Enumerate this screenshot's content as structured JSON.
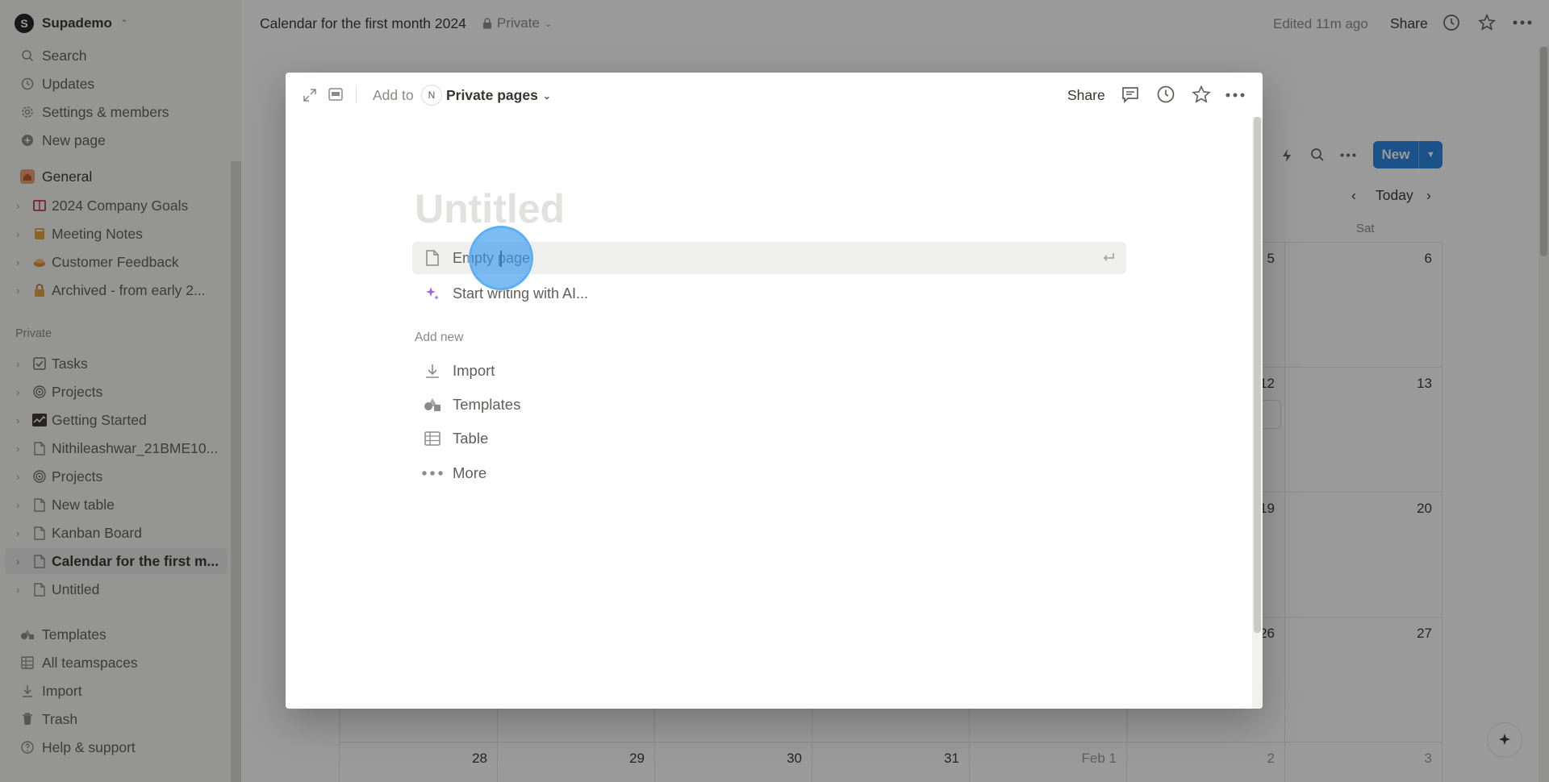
{
  "workspace": {
    "initial": "S",
    "name": "Supademo"
  },
  "sidebar": {
    "top_items": [
      {
        "label": "Search",
        "icon": "search-icon"
      },
      {
        "label": "Updates",
        "icon": "clock-icon"
      },
      {
        "label": "Settings & members",
        "icon": "gear-icon"
      },
      {
        "label": "New page",
        "icon": "plus-circle-icon"
      }
    ],
    "teamspace_items": [
      {
        "label": "General",
        "icon": "home-icon"
      },
      {
        "label": "2024 Company Goals",
        "icon": "book-icon"
      },
      {
        "label": "Meeting Notes",
        "icon": "notebook-icon"
      },
      {
        "label": "Customer Feedback",
        "icon": "food-icon"
      },
      {
        "label": "Archived - from early 2...",
        "icon": "lock-icon"
      }
    ],
    "private_label": "Private",
    "private_items": [
      {
        "label": "Tasks",
        "icon": "checkbox-icon"
      },
      {
        "label": "Projects",
        "icon": "target-icon"
      },
      {
        "label": "Getting Started",
        "icon": "chart-icon"
      },
      {
        "label": "Nithileashwar_21BME10...",
        "icon": "page-icon"
      },
      {
        "label": "Projects",
        "icon": "target-icon"
      },
      {
        "label": "New table",
        "icon": "page-icon"
      },
      {
        "label": "Kanban Board",
        "icon": "page-icon"
      },
      {
        "label": "Calendar for the first m...",
        "icon": "page-icon"
      },
      {
        "label": "Untitled",
        "icon": "page-icon"
      }
    ],
    "bottom_items": [
      {
        "label": "Templates",
        "icon": "templates-icon"
      },
      {
        "label": "All teamspaces",
        "icon": "grid-icon"
      },
      {
        "label": "Import",
        "icon": "download-icon"
      },
      {
        "label": "Trash",
        "icon": "trash-icon"
      },
      {
        "label": "Help & support",
        "icon": "help-icon"
      }
    ]
  },
  "topbar": {
    "title": "Calendar for the first month 2024",
    "privacy": "Private",
    "edited": "Edited 11m ago",
    "share": "Share"
  },
  "calendar": {
    "new_label": "New",
    "today_label": "Today",
    "day_header": "Sat",
    "dates": [
      "5",
      "6",
      "12",
      "13",
      "19",
      "20",
      "26",
      "27",
      "28",
      "29",
      "30",
      "31",
      "Feb 1",
      "2",
      "3"
    ]
  },
  "modal": {
    "add_to": "Add to",
    "location_initial": "N",
    "location": "Private pages",
    "share": "Share",
    "title_placeholder": "Untitled",
    "options": [
      {
        "label": "Empty page",
        "icon": "page-icon"
      },
      {
        "label": "Start writing with AI...",
        "icon": "sparkle-icon"
      }
    ],
    "add_new_label": "Add new",
    "add_new_items": [
      {
        "label": "Import",
        "icon": "download-icon"
      },
      {
        "label": "Templates",
        "icon": "templates-icon"
      },
      {
        "label": "Table",
        "icon": "table-icon"
      },
      {
        "label": "More",
        "icon": "more-icon"
      }
    ]
  },
  "colors": {
    "accent": "#2383e2",
    "sidebar_bg": "#f7f7f5",
    "overlay": "#0f0f0f"
  }
}
